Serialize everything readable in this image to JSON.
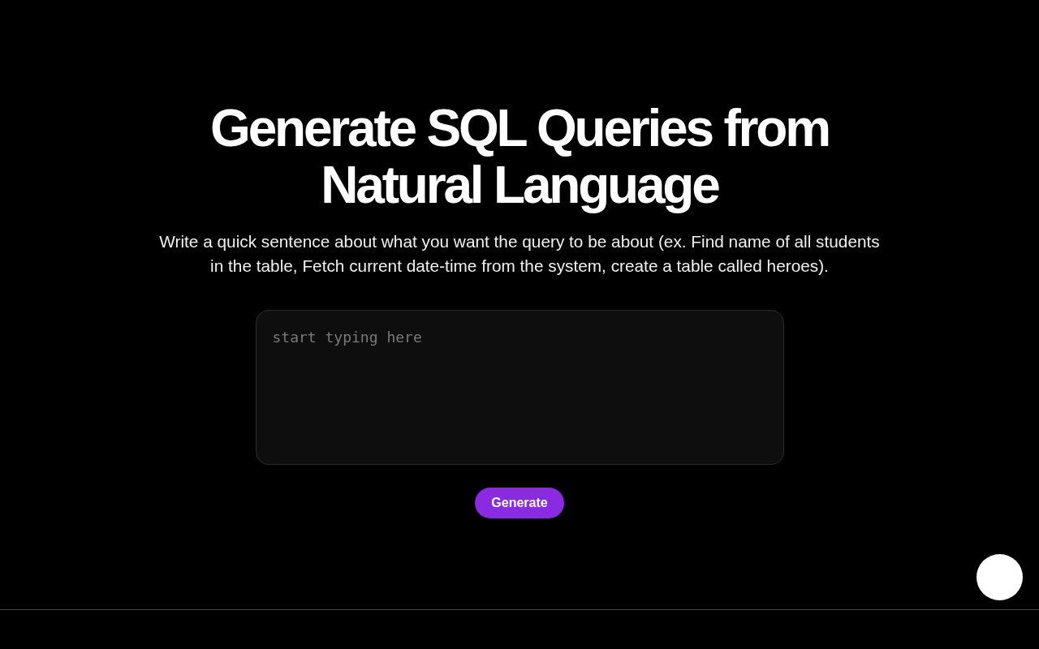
{
  "heading": "Generate SQL Queries from Natural Language",
  "description": "Write a quick sentence about what you want the query to be about (ex. Find name of all students in the table, Fetch current date-time from the system, create a table called heroes).",
  "query_input": {
    "placeholder": "start typing here"
  },
  "generate_button": {
    "label": "Generate"
  }
}
